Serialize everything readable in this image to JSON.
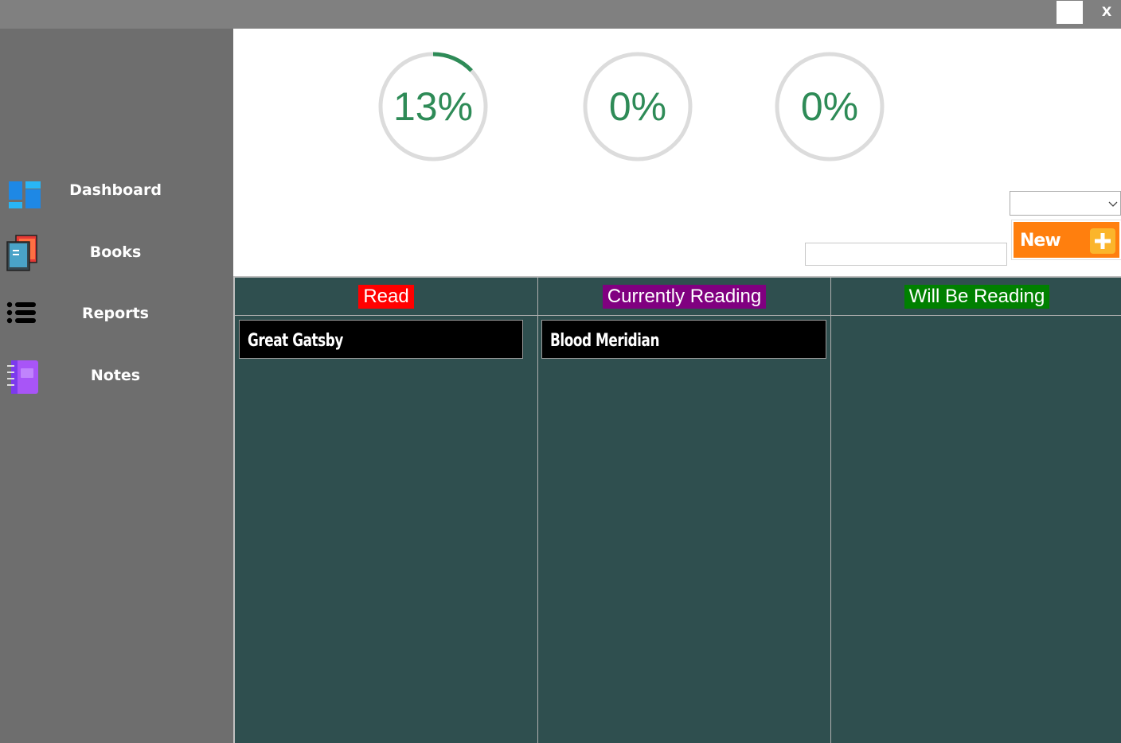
{
  "titlebar": {
    "close_label": "X"
  },
  "sidebar": {
    "items": [
      {
        "label": "Dashboard",
        "icon": "dashboard-icon"
      },
      {
        "label": "Books",
        "icon": "books-icon"
      },
      {
        "label": "Reports",
        "icon": "list-icon"
      },
      {
        "label": "Notes",
        "icon": "notebook-icon"
      }
    ]
  },
  "stats": {
    "gauges": [
      {
        "text": "13%",
        "progress": 0.13
      },
      {
        "text": "0%",
        "progress": 0
      },
      {
        "text": "0%",
        "progress": 0
      }
    ]
  },
  "toolbar": {
    "filter_value": "",
    "new_label": "New",
    "search_value": ""
  },
  "board": {
    "columns": [
      {
        "title": "Read",
        "color": "#ff0000",
        "cards": [
          {
            "title": "Great Gatsby"
          }
        ]
      },
      {
        "title": "Currently Reading",
        "color": "#800080",
        "cards": [
          {
            "title": "Blood Meridian"
          }
        ]
      },
      {
        "title": "Will Be Reading",
        "color": "#008000",
        "cards": []
      }
    ]
  },
  "colors": {
    "sidebar_bg": "#6e6e6e",
    "titlebar_bg": "#808080",
    "board_bg": "#2f4f4f",
    "gauge_track": "#dcdcdc",
    "gauge_fill": "#2e8b57",
    "new_button": "#ff7f0e"
  }
}
